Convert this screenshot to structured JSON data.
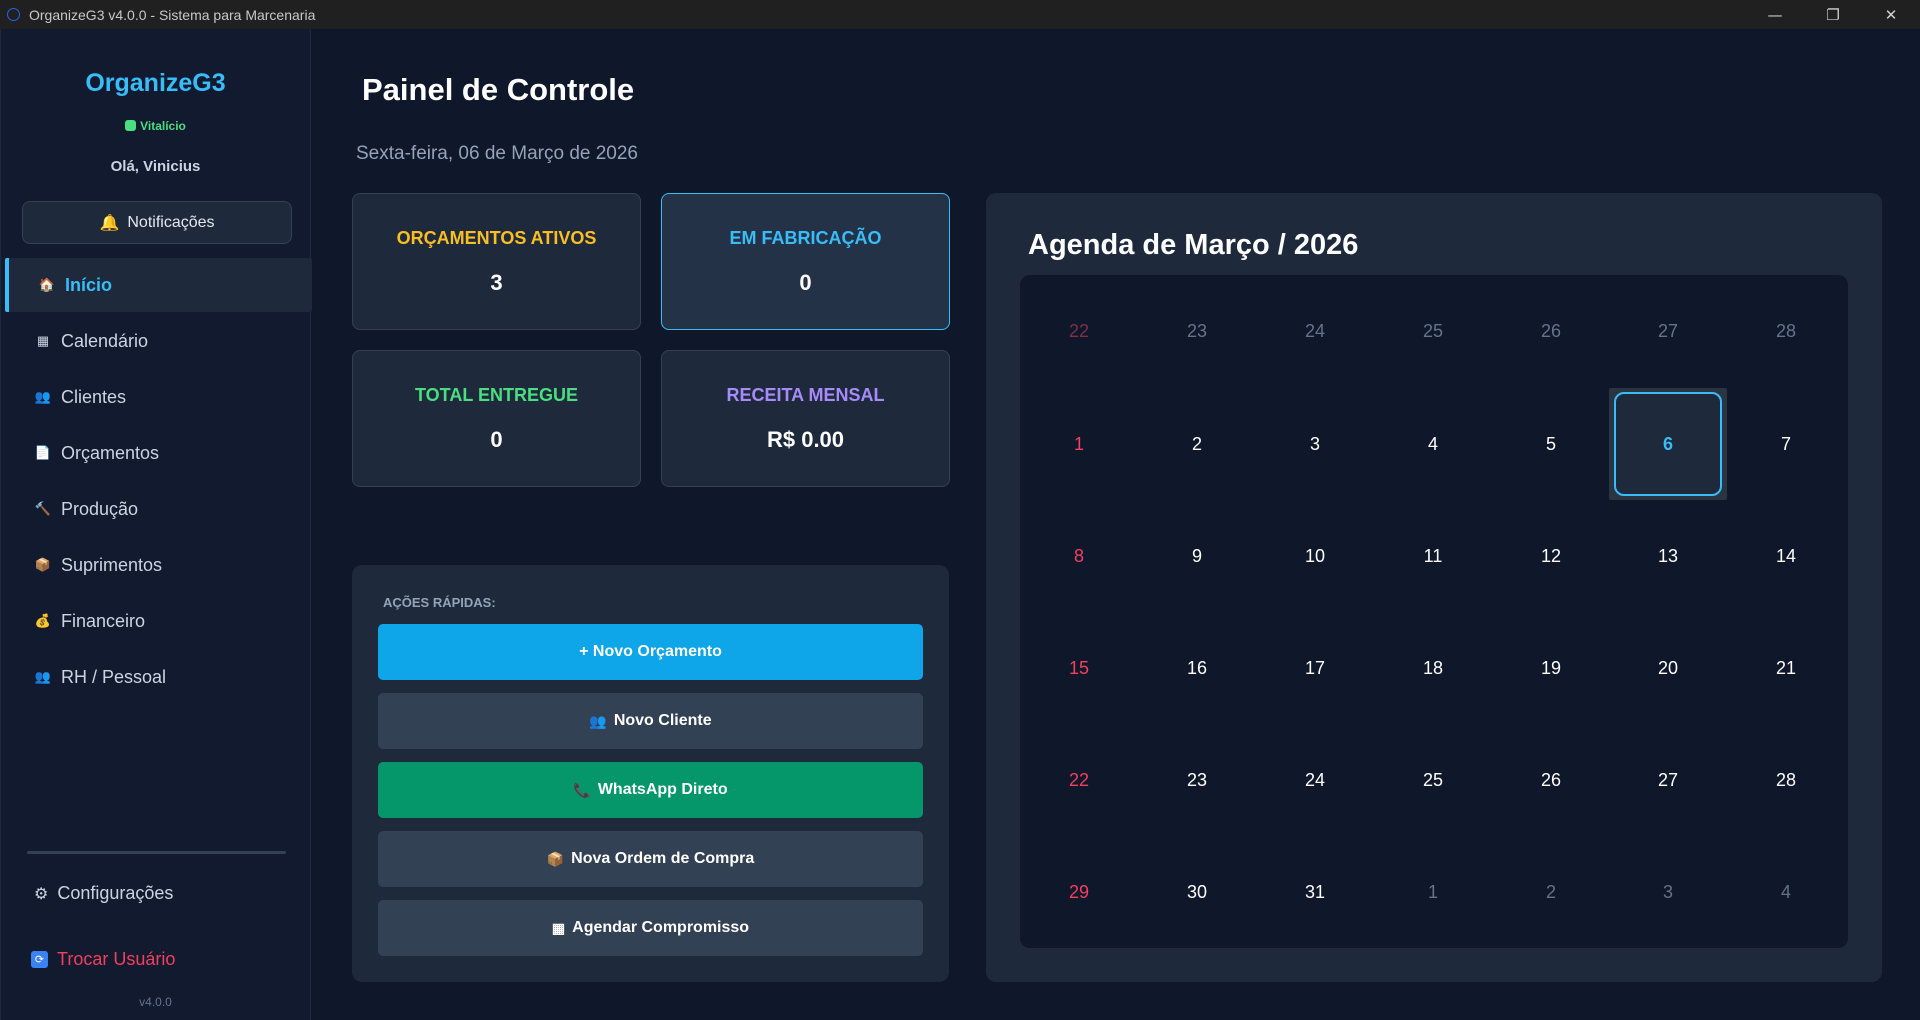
{
  "window": {
    "title": "OrganizeG3 v4.0.0 - Sistema para Marcenaria",
    "minimize": "—",
    "maximize": "❐",
    "close": "✕"
  },
  "sidebar": {
    "brand": "OrganizeG3",
    "plan": "Vitalício",
    "greeting": "Olá, Vinicius",
    "notifications_label": "Notificações",
    "items": [
      {
        "label": "Início",
        "icon": "home-icon",
        "glyph": "🏠",
        "active": true
      },
      {
        "label": "Calendário",
        "icon": "calendar-icon",
        "glyph": "▦"
      },
      {
        "label": "Clientes",
        "icon": "users-icon",
        "glyph": "👥"
      },
      {
        "label": "Orçamentos",
        "icon": "document-icon",
        "glyph": "📄"
      },
      {
        "label": "Produção",
        "icon": "hammer-icon",
        "glyph": "🔨"
      },
      {
        "label": "Suprimentos",
        "icon": "box-icon",
        "glyph": "📦"
      },
      {
        "label": "Financeiro",
        "icon": "money-bag-icon",
        "glyph": "💰"
      },
      {
        "label": "RH / Pessoal",
        "icon": "people-icon",
        "glyph": "👥"
      }
    ],
    "settings_label": "Configurações",
    "switch_user_label": "Trocar Usuário",
    "version": "v4.0.0"
  },
  "main": {
    "title": "Painel de Controle",
    "date": "Sexta-feira, 06 de Março de 2026",
    "stats": [
      {
        "label": "ORÇAMENTOS ATIVOS",
        "value": "3",
        "color": "#fbbf24"
      },
      {
        "label": "EM FABRICAÇÃO",
        "value": "0",
        "color": "#38bdf8"
      },
      {
        "label": "TOTAL ENTREGUE",
        "value": "0",
        "color": "#4ade80"
      },
      {
        "label": "RECEITA MENSAL",
        "value": "R$ 0.00",
        "color": "#a78bfa"
      }
    ],
    "quick_actions": {
      "title": "AÇÕES RÁPIDAS:",
      "buttons": [
        {
          "label": "+ Novo Orçamento",
          "icon": "",
          "color": "#0ea5e9"
        },
        {
          "label": "Novo Cliente",
          "icon": "👥",
          "color": "#334155"
        },
        {
          "label": "WhatsApp Direto",
          "icon": "📞",
          "color": "#059669"
        },
        {
          "label": "Nova Ordem de Compra",
          "icon": "📦",
          "color": "#334155"
        },
        {
          "label": "Agendar Compromisso",
          "icon": "▦",
          "color": "#334155"
        }
      ]
    },
    "agenda": {
      "title": "Agenda de Março / 2026",
      "today": 6,
      "weeks": [
        [
          {
            "d": "22",
            "m": true
          },
          {
            "d": "23",
            "m": true
          },
          {
            "d": "24",
            "m": true
          },
          {
            "d": "25",
            "m": true
          },
          {
            "d": "26",
            "m": true
          },
          {
            "d": "27",
            "m": true
          },
          {
            "d": "28",
            "m": true
          }
        ],
        [
          {
            "d": "1"
          },
          {
            "d": "2"
          },
          {
            "d": "3"
          },
          {
            "d": "4"
          },
          {
            "d": "5"
          },
          {
            "d": "6"
          },
          {
            "d": "7"
          }
        ],
        [
          {
            "d": "8"
          },
          {
            "d": "9"
          },
          {
            "d": "10"
          },
          {
            "d": "11"
          },
          {
            "d": "12"
          },
          {
            "d": "13"
          },
          {
            "d": "14"
          }
        ],
        [
          {
            "d": "15"
          },
          {
            "d": "16"
          },
          {
            "d": "17"
          },
          {
            "d": "18"
          },
          {
            "d": "19"
          },
          {
            "d": "20"
          },
          {
            "d": "21"
          }
        ],
        [
          {
            "d": "22"
          },
          {
            "d": "23"
          },
          {
            "d": "24"
          },
          {
            "d": "25"
          },
          {
            "d": "26"
          },
          {
            "d": "27"
          },
          {
            "d": "28"
          }
        ],
        [
          {
            "d": "29"
          },
          {
            "d": "30"
          },
          {
            "d": "31"
          },
          {
            "d": "1",
            "m": true
          },
          {
            "d": "2",
            "m": true
          },
          {
            "d": "3",
            "m": true
          },
          {
            "d": "4",
            "m": true
          }
        ]
      ]
    }
  }
}
